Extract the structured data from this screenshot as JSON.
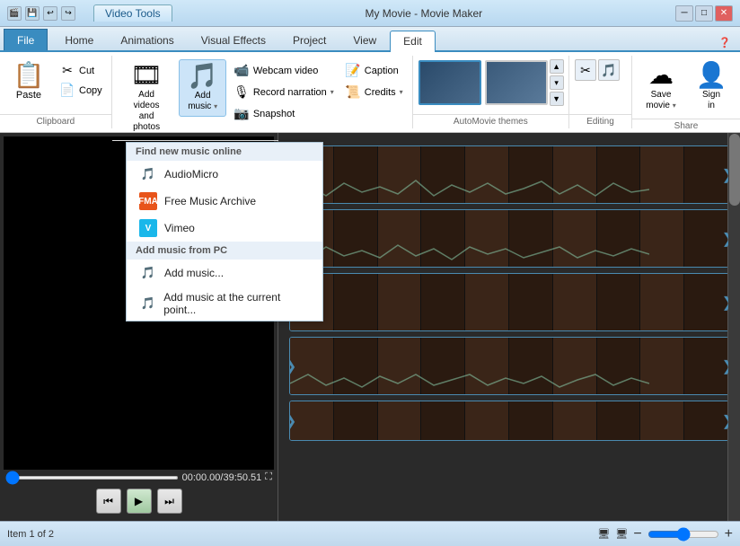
{
  "titleBar": {
    "appName": "My Movie - Movie Maker",
    "videoToolsLabel": "Video Tools",
    "controls": [
      "─",
      "□",
      "✕"
    ]
  },
  "ribbonTabs": {
    "tabs": [
      "File",
      "Home",
      "Animations",
      "Visual Effects",
      "Project",
      "View",
      "Edit"
    ],
    "activeTab": "Edit"
  },
  "clipboardGroup": {
    "label": "Clipboard",
    "pasteLabel": "Paste",
    "cutLabel": "Cut",
    "copyLabel": "Copy"
  },
  "addGroup": {
    "addVideosLabel": "Add videos\nand photos",
    "addMusicLabel": "Add\nmusic",
    "webcamLabel": "Webcam video",
    "recordNarrationLabel": "Record narration",
    "captionLabel": "Caption",
    "snapshotLabel": "Snapshot",
    "creditsLabel": "Credits"
  },
  "autoMovieThemes": {
    "label": "AutoMovie themes",
    "themes": [
      "theme1",
      "theme2"
    ]
  },
  "editingGroup": {
    "label": "Editing",
    "buttons": [
      "✂",
      "🎵"
    ]
  },
  "shareGroup": {
    "label": "Share",
    "saveMovieLabel": "Save\nmovie",
    "signInLabel": "Sign\nin"
  },
  "dropdown": {
    "findMusicOnlineLabel": "Find new music online",
    "items": [
      {
        "icon": "🎵",
        "label": "AudioMicro"
      },
      {
        "icon": "🎵",
        "label": "Free Music Archive"
      },
      {
        "icon": "🎵",
        "label": "Vimeo"
      }
    ],
    "addFromPCLabel": "Add music from PC",
    "pcItems": [
      {
        "icon": "🎵",
        "label": "Add music..."
      },
      {
        "icon": "🎵",
        "label": "Add music at the current point..."
      }
    ]
  },
  "preview": {
    "timeLabel": "00:00.00/39:50.51",
    "expandIcon": "⛶"
  },
  "statusBar": {
    "itemText": "Item 1 of 2",
    "monitorIcon": "🖥",
    "zoomMinus": "−",
    "zoomPlus": "+"
  }
}
